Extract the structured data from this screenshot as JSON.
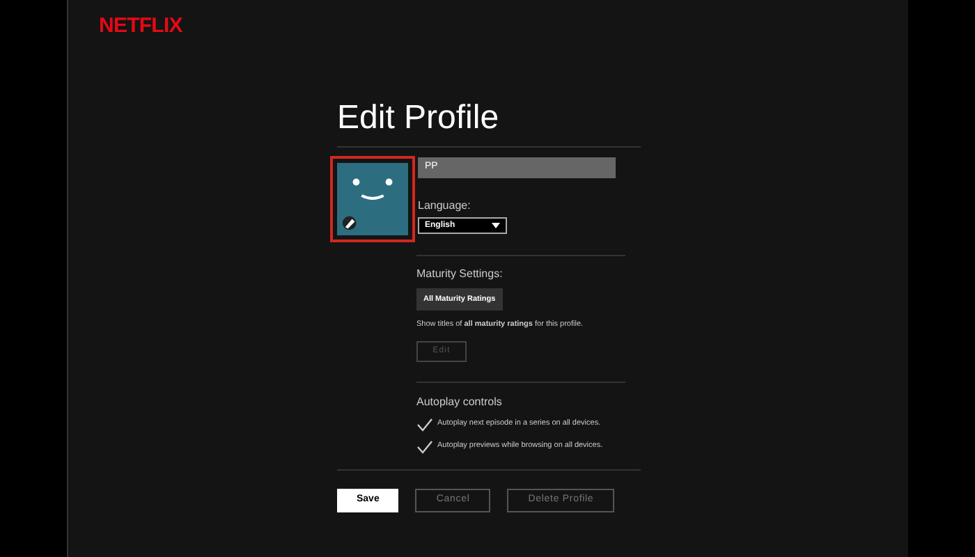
{
  "logo": "NETFLIX",
  "title": "Edit Profile",
  "profile": {
    "name": "PP",
    "language_label": "Language:",
    "language": "English"
  },
  "maturity": {
    "heading": "Maturity Settings:",
    "badge": "All Maturity Ratings",
    "description": "Show titles of **all maturity ratings** for this profile.",
    "edit_button": "Edit",
    "edit_disabled": true
  },
  "autoplay": {
    "heading": "Autoplay controls",
    "options": [
      {
        "label": "Autoplay next episode in a series on all devices.",
        "checked": true
      },
      {
        "label": "Autoplay previews while browsing on all devices.",
        "checked": true
      }
    ]
  },
  "buttons": [
    {
      "label": "Save",
      "kind": "primary"
    },
    {
      "label": "Cancel",
      "kind": "secondary"
    },
    {
      "label": "Delete Profile",
      "kind": "secondary"
    }
  ]
}
